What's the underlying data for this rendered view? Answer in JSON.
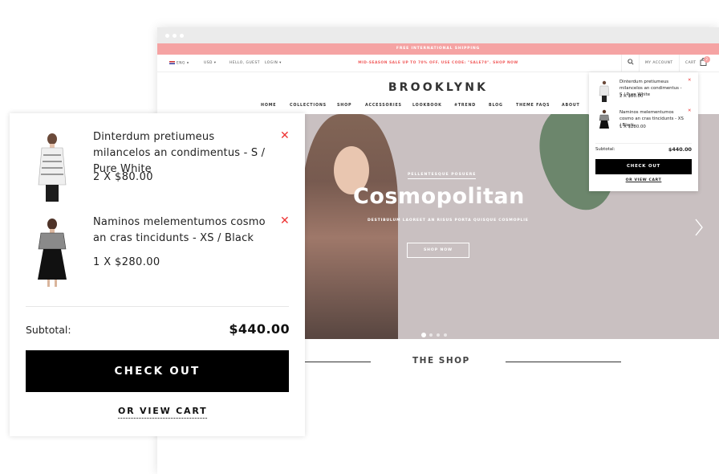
{
  "site": {
    "promo_text": "FREE INTERNATIONAL SHIPPING",
    "topbar": {
      "language": "ENG",
      "currency": "USD",
      "greeting": "HELLO, GUEST",
      "login": "LOGIN",
      "sale_text": "MID-SEASON SALE UP TO 70% OFF. USE CODE: \"SALE70\". SHOP NOW",
      "my_account": "MY ACCOUNT",
      "cart": "CART",
      "cart_count": "2"
    },
    "logo": "BROOKLYNK",
    "nav": [
      "HOME",
      "COLLECTIONS",
      "SHOP",
      "ACCESSORIES",
      "LOOKBOOK",
      "#TREND",
      "BLOG",
      "THEME FAQS",
      "ABOUT"
    ],
    "hero": {
      "kicker": "PELLENTESQUE POSUERE",
      "headline": "Cosmopolitan",
      "sub": "DESTIBULUM LAOREET AN RISUS PORTA QUISQUE COSMOPLIE",
      "button": "SHOP NOW",
      "slide_count": 4,
      "active_slide": 1
    },
    "section_title": "THE SHOP"
  },
  "cart": {
    "items": [
      {
        "name": "Dinterdum pretiumeus milancelos an condimentus - S / Pure White",
        "qty_price": "2 X $80.00"
      },
      {
        "name": "Naminos melementumos cosmo an cras tincidunts - XS / Black",
        "qty_price": "1 X $280.00"
      }
    ],
    "subtotal_label": "Subtotal:",
    "subtotal_value": "$440.00",
    "checkout_label": "CHECK OUT",
    "view_cart_label": "OR VIEW CART"
  },
  "colors": {
    "promo": "#f5a3a3",
    "sale_text": "#f05a5a",
    "remove": "#e33333",
    "button": "#000000"
  },
  "icons": {
    "search": "search-icon",
    "cart": "bag-icon",
    "remove": "close-icon",
    "next": "chevron-right-icon",
    "flag": "us-flag-icon"
  }
}
